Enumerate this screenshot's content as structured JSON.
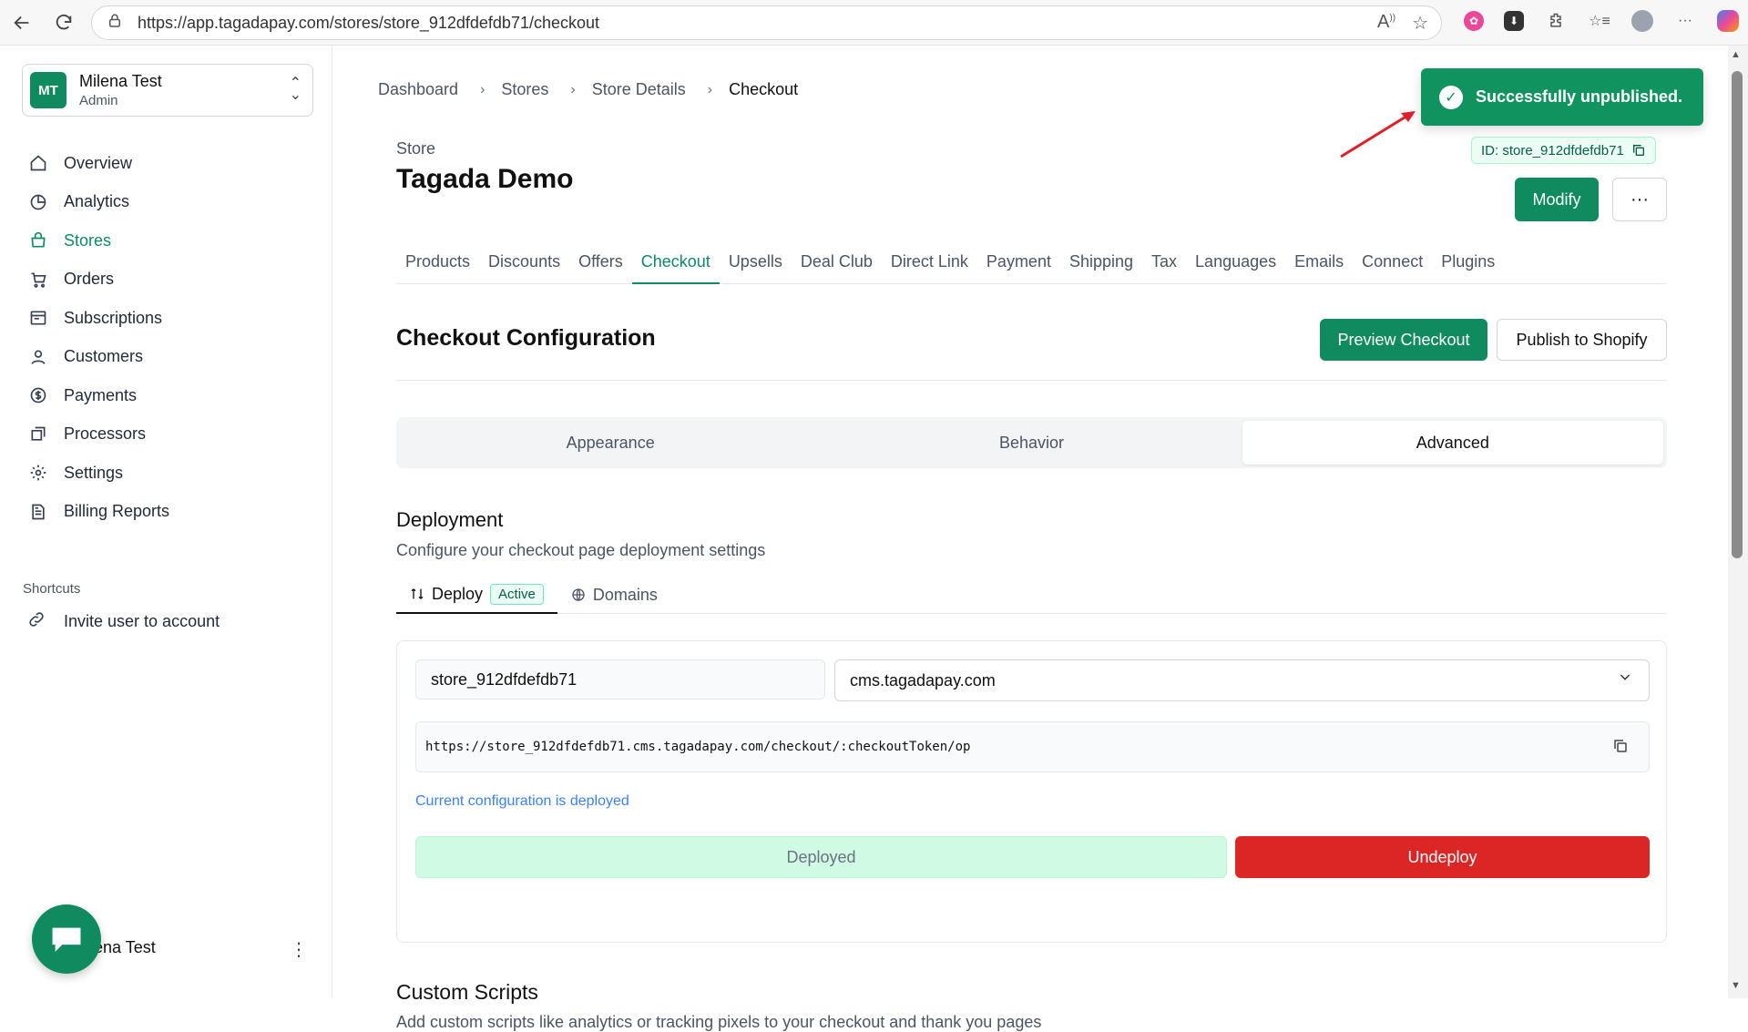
{
  "browser": {
    "url": "https://app.tagadapay.com/stores/store_912dfdefdb71/checkout"
  },
  "sidebar": {
    "user": {
      "initials": "MT",
      "name": "Milena Test",
      "role": "Admin"
    },
    "items": [
      {
        "label": "Overview",
        "icon": "home-icon"
      },
      {
        "label": "Analytics",
        "icon": "pie-chart-icon"
      },
      {
        "label": "Stores",
        "icon": "store-icon",
        "active": true
      },
      {
        "label": "Orders",
        "icon": "cart-icon"
      },
      {
        "label": "Subscriptions",
        "icon": "subscriptions-icon"
      },
      {
        "label": "Customers",
        "icon": "user-icon"
      },
      {
        "label": "Payments",
        "icon": "dollar-icon"
      },
      {
        "label": "Processors",
        "icon": "processor-icon"
      },
      {
        "label": "Settings",
        "icon": "gear-icon"
      },
      {
        "label": "Billing Reports",
        "icon": "report-icon"
      }
    ],
    "shortcuts_label": "Shortcuts",
    "shortcut": "Invite user to account",
    "bottom_user": "ilena Test"
  },
  "breadcrumb": [
    "Dashboard",
    "Stores",
    "Store Details",
    "Checkout"
  ],
  "store": {
    "label": "Store",
    "title": "Tagada Demo",
    "id_badge": "ID: store_912dfdefdb71"
  },
  "actions": {
    "modify": "Modify",
    "more": "···"
  },
  "tabs": [
    "Products",
    "Discounts",
    "Offers",
    "Checkout",
    "Upsells",
    "Deal Club",
    "Direct Link",
    "Payment",
    "Shipping",
    "Tax",
    "Languages",
    "Emails",
    "Connect",
    "Plugins"
  ],
  "active_tab": "Checkout",
  "checkout": {
    "title": "Checkout Configuration",
    "preview": "Preview Checkout",
    "publish": "Publish to Shopify",
    "segments": [
      "Appearance",
      "Behavior",
      "Advanced"
    ],
    "active_segment": "Advanced"
  },
  "deployment": {
    "title": "Deployment",
    "desc": "Configure your checkout page deployment settings",
    "subtab_deploy": "Deploy",
    "badge": "Active",
    "subtab_domains": "Domains",
    "subdomain": "store_912dfdefdb71",
    "domain": "cms.tagadapay.com",
    "url": "https://store_912dfdefdb71.cms.tagadapay.com/checkout/:checkoutToken/op",
    "status": "Current configuration is deployed",
    "deployed": "Deployed",
    "undeploy": "Undeploy"
  },
  "custom_scripts": {
    "title": "Custom Scripts",
    "desc": "Add custom scripts like analytics or tracking pixels to your checkout and thank you pages"
  },
  "toast": {
    "message": "Successfully unpublished."
  },
  "colors": {
    "brand": "#0f8b5f",
    "danger": "#dc2626",
    "link": "#3b82f6"
  }
}
